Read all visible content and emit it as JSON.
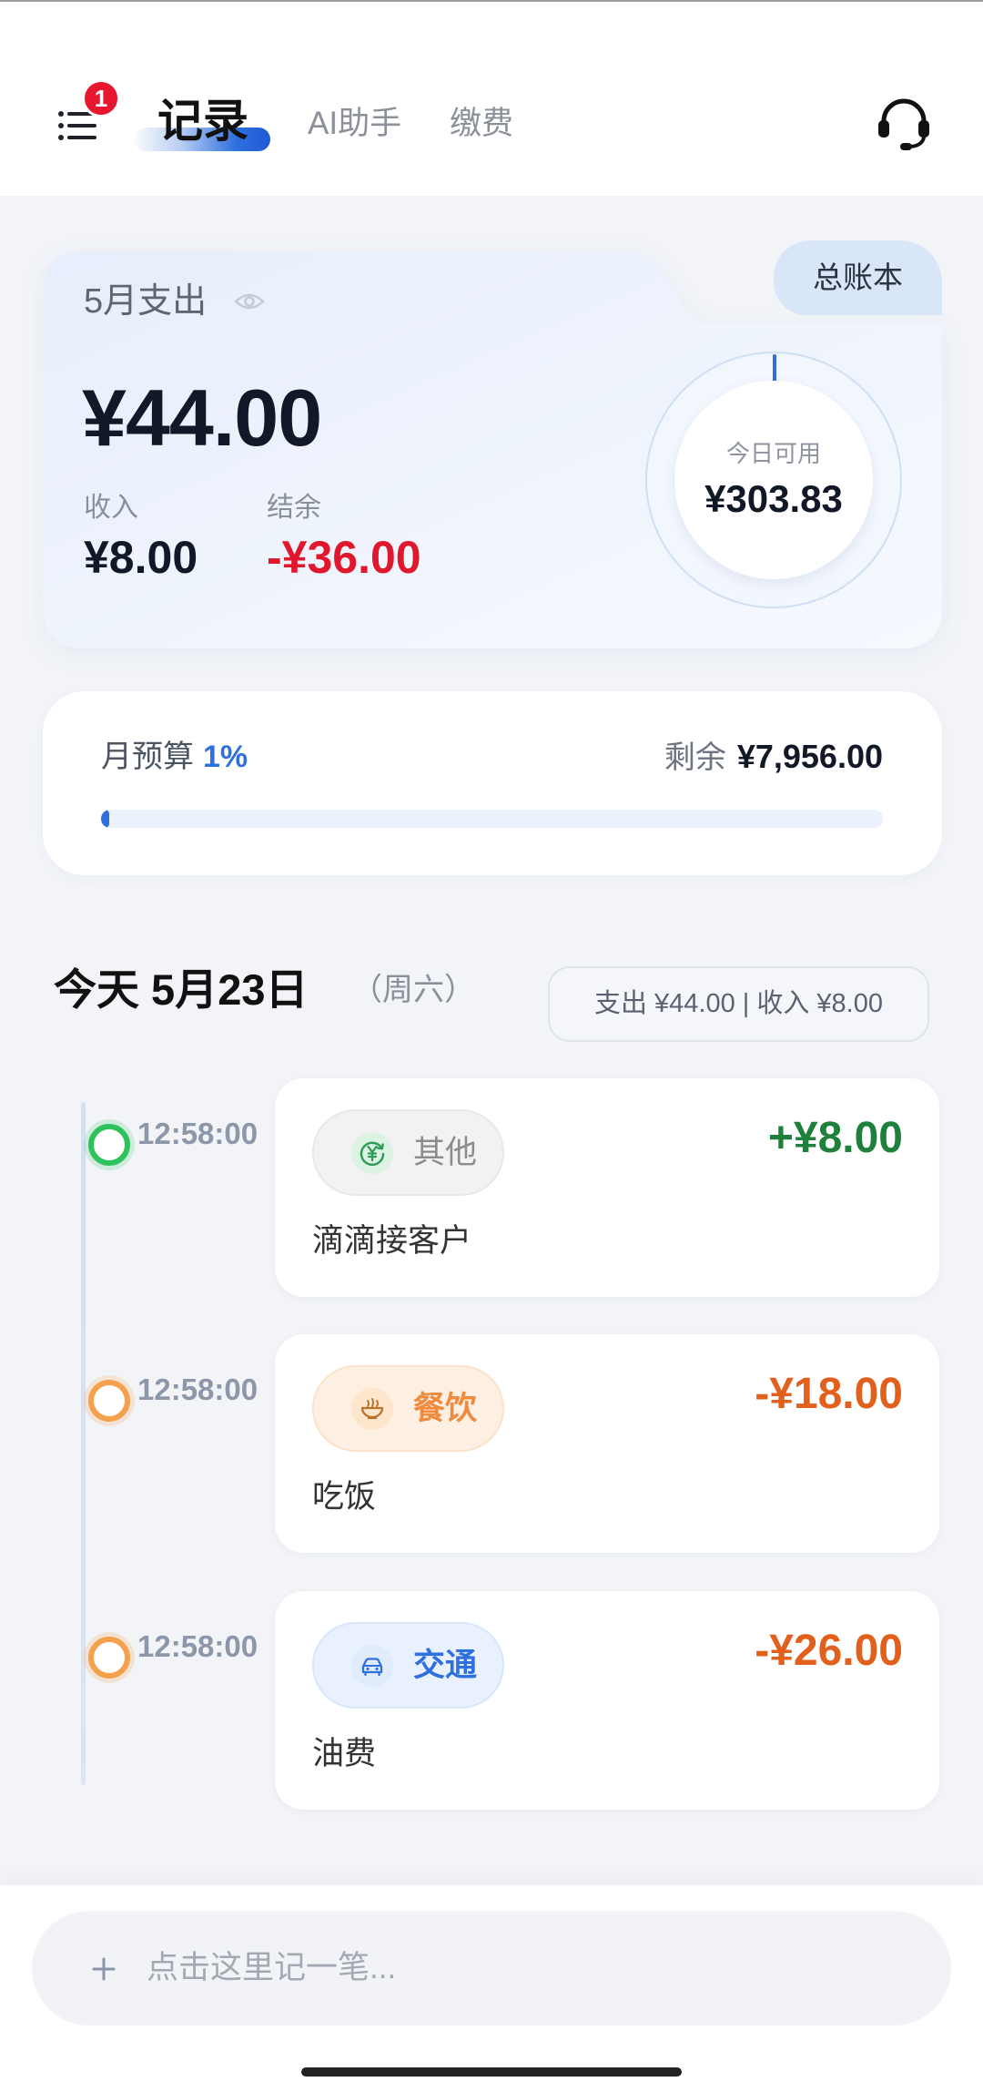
{
  "header": {
    "notification_count": "1",
    "tabs": [
      {
        "label": "记录",
        "active": true
      },
      {
        "label": "AI助手",
        "active": false
      },
      {
        "label": "缴费",
        "active": false
      }
    ],
    "menu_icon": "list-icon",
    "support_icon": "headset-icon"
  },
  "summary": {
    "ledger_label": "总账本",
    "month_expense_label": "5月支出",
    "visibility_icon": "eye-icon",
    "month_expense": "¥44.00",
    "income_label": "收入",
    "income": "¥8.00",
    "balance_label": "结余",
    "balance": "-¥36.00",
    "today_label": "今日可用",
    "today_available": "¥303.83"
  },
  "budget": {
    "label": "月预算",
    "percent": "1%",
    "used_fraction": 0.01,
    "remaining_label": "剩余",
    "remaining": "¥7,956.00"
  },
  "day": {
    "title": "今天 5月23日",
    "weekday": "（周六）",
    "totals": "支出 ¥44.00 | 收入 ¥8.00"
  },
  "records": [
    {
      "time": "12:58:00",
      "category": "其他",
      "category_icon": "yen-exchange-icon",
      "note": "滴滴接客户",
      "amount": "+¥8.00",
      "amount_color": "#1f803c"
    },
    {
      "time": "12:58:00",
      "category": "餐饮",
      "category_icon": "bowl-icon",
      "note": "吃饭",
      "amount": "-¥18.00",
      "amount_color": "#e0601c"
    },
    {
      "time": "12:58:00",
      "category": "交通",
      "category_icon": "car-icon",
      "note": "油费",
      "amount": "-¥26.00",
      "amount_color": "#e0601c"
    }
  ],
  "composer": {
    "icon": "plus-icon",
    "placeholder": "点击这里记一笔..."
  },
  "colors": {
    "accent": "#2f6fde",
    "negative": "#e0182d",
    "income": "#1f803c",
    "expense": "#e0601c",
    "notification": "#e8172f"
  }
}
